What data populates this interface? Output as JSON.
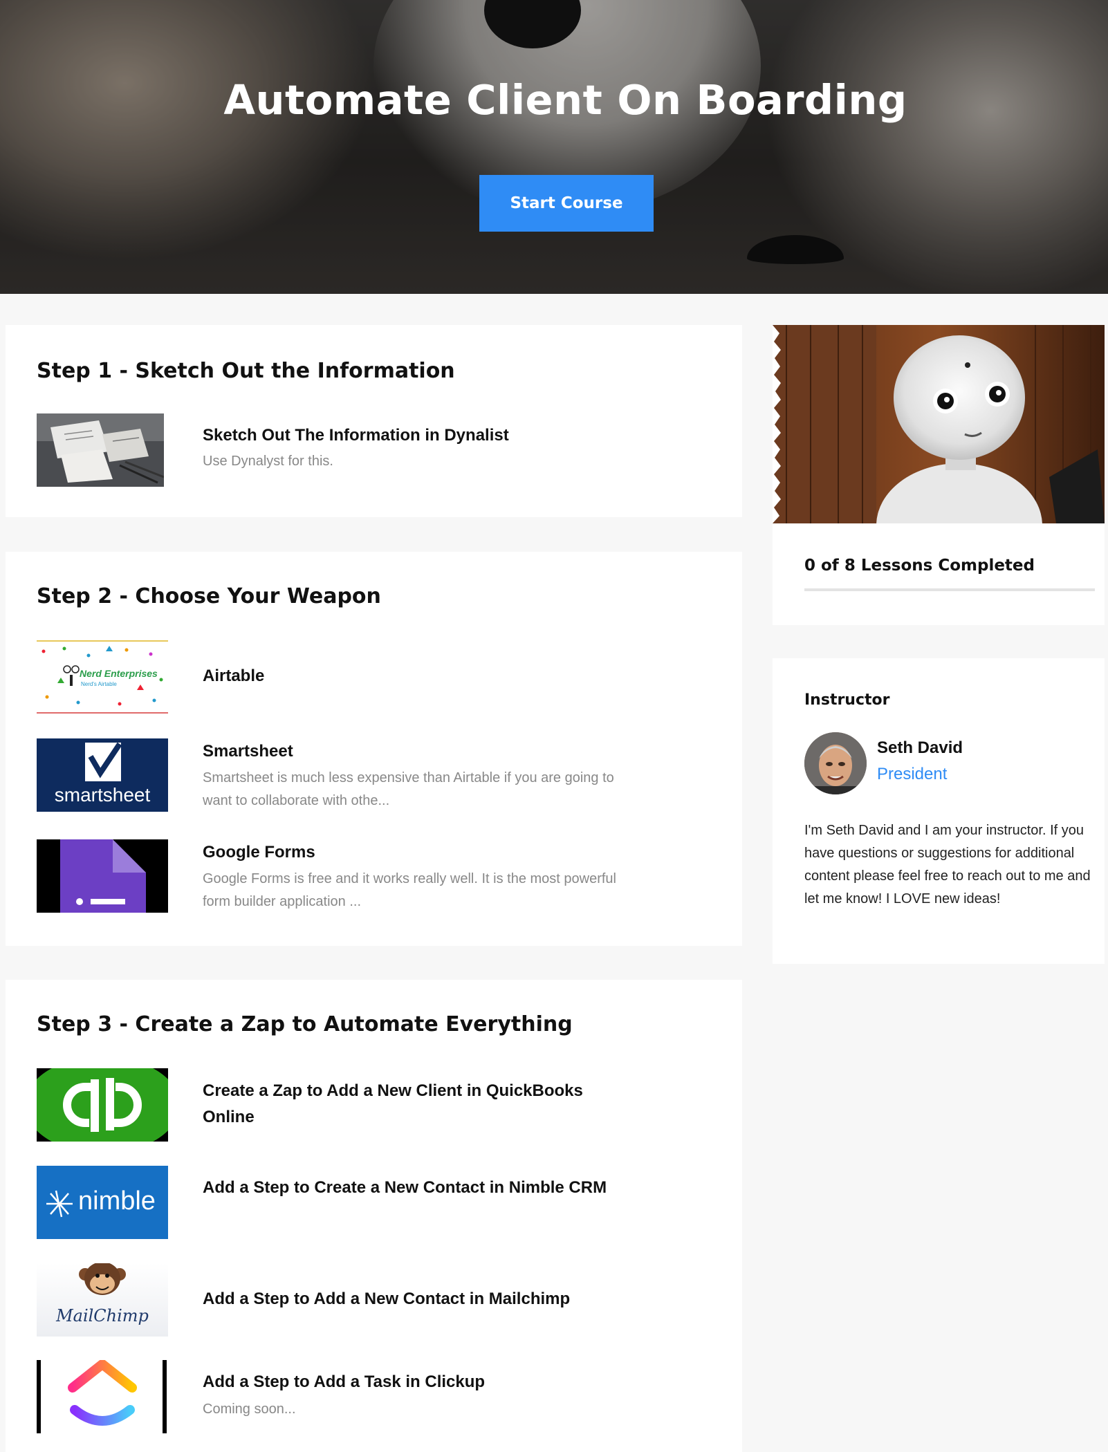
{
  "hero": {
    "title": "Automate Client On Boarding",
    "start_button": "Start Course"
  },
  "steps": [
    {
      "title": "Step 1 - Sketch Out the Information",
      "lessons": [
        {
          "title": "Sketch Out The Information in Dynalist",
          "description": "Use Dynalyst for this.",
          "thumbnail": "desk-photo"
        }
      ]
    },
    {
      "title": "Step 2 - Choose Your Weapon",
      "lessons": [
        {
          "title": "Airtable",
          "description": "",
          "thumbnail": "nerd-enterprises-logo",
          "thumb_text": "Nerd Enterprises",
          "thumb_subtext": "Nerd's Airtable"
        },
        {
          "title": "Smartsheet",
          "description": "Smartsheet is much less expensive than Airtable if you are going to want to collaborate with othe...",
          "thumbnail": "smartsheet-logo",
          "thumb_text": "smartsheet"
        },
        {
          "title": "Google Forms",
          "description": "Google Forms is free and it works really well. It is the most powerful form builder application ...",
          "thumbnail": "google-forms-logo"
        }
      ]
    },
    {
      "title": "Step 3 - Create a Zap to Automate Everything",
      "lessons": [
        {
          "title": "Create a Zap to Add a New Client in QuickBooks Online",
          "description": "",
          "thumbnail": "quickbooks-logo"
        },
        {
          "title": "Add a Step to Create a New Contact in Nimble CRM",
          "description": "",
          "thumbnail": "nimble-logo",
          "thumb_text": "nimble"
        },
        {
          "title": "Add a Step to Add a New Contact in Mailchimp",
          "description": "",
          "thumbnail": "mailchimp-logo",
          "thumb_text": "MailChimp"
        },
        {
          "title": "Add a Step to Add a Task in Clickup",
          "description": "Coming soon...",
          "thumbnail": "clickup-logo"
        }
      ]
    }
  ],
  "sidebar": {
    "course_image": "robot-photo",
    "progress": {
      "label": "0 of 8 Lessons Completed",
      "completed": 0,
      "total": 8
    },
    "instructor": {
      "heading": "Instructor",
      "name": "Seth David",
      "role": "President",
      "bio": "I'm Seth David and I am your instructor. If you have questions or suggestions for additional content please feel free to reach out to me and let me know! I LOVE new ideas!"
    }
  },
  "colors": {
    "accent": "#2f8cf5",
    "page_bg": "#f7f7f7",
    "muted_text": "#888888"
  }
}
